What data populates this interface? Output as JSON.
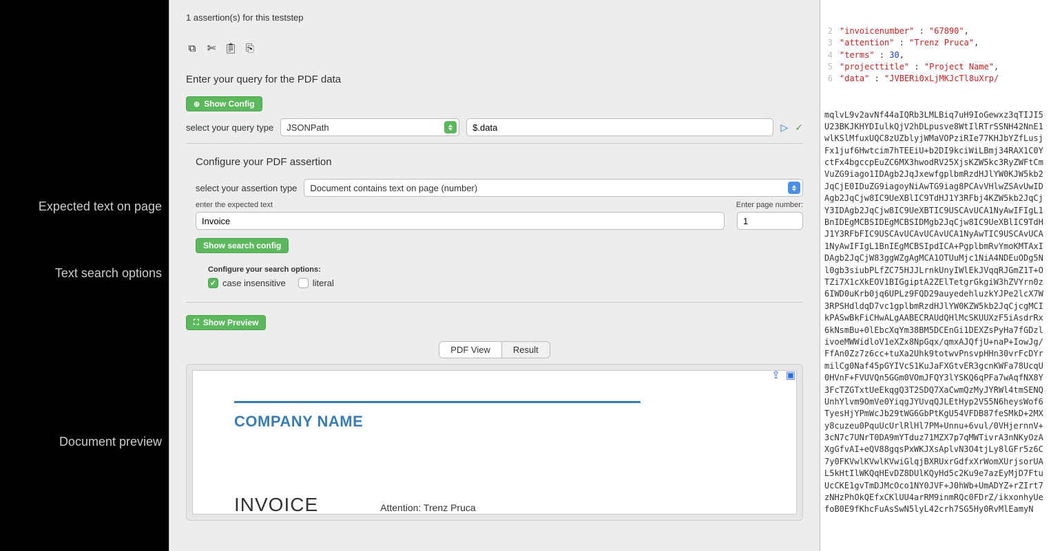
{
  "left_labels": {
    "l1": "Expected text on page",
    "l2": "Text search options",
    "l3": "Document preview"
  },
  "assertion_header": "1 assertion(s) for this teststep",
  "query_section": {
    "title": "Enter your query for the PDF data",
    "show_config_btn": "Show Config",
    "query_type_label": "select your query type",
    "query_type_value": "JSONPath",
    "query_input_value": "$.data"
  },
  "assertion_section": {
    "title": "Configure your PDF assertion",
    "type_label": "select your assertion type",
    "type_value": "Document contains text on page (number)",
    "expected_label": "enter the expected text",
    "page_label": "Enter page number:",
    "expected_value": "Invoice",
    "page_value": "1",
    "show_search_btn": "Show search config",
    "search_opts_title": "Configure your search options:",
    "case_insensitive_label": "case insensitive",
    "literal_label": "literal",
    "case_insensitive_checked": true,
    "literal_checked": false
  },
  "preview_section": {
    "show_preview_btn": "Show Preview",
    "tab_pdf": "PDF View",
    "tab_result": "Result"
  },
  "pdf": {
    "company": "COMPANY NAME",
    "invoice_word": "INVOICE",
    "attention": "Attention: Trenz Pruca"
  },
  "json_lines": [
    {
      "n": "2",
      "key": "invoicenumber",
      "val_str": "67890",
      "trail": ","
    },
    {
      "n": "3",
      "key": "attention",
      "val_str": "Trenz Pruca",
      "trail": ","
    },
    {
      "n": "4",
      "key": "terms",
      "val_num": "30",
      "trail": ","
    },
    {
      "n": "5",
      "key": "projecttitle",
      "val_str": "Project Name",
      "trail": ","
    },
    {
      "n": "6",
      "key": "data",
      "val_str_prefix": "JVBERi0xLjMKJcTl8uXrp/"
    }
  ],
  "base64_blob": "mqlvL9v2avNf44aIQRb3LMLBiq7uH9IoGewxz3qTIJI5U23BKJKHYDIulkQjV2hDLpusve8WtIlRTrSSNH42NnE1wlKSlMfuxUQC8zUZblyjWMaVOPziRIe77KHJbYZfLusjFx1juf6Hwtcim7hTEEiU+b2DI9kciWiLBmj34RAX1C0YctFx4bgccpEuZC6MX3hwodRV25XjsKZW5kc3RyZWFtCmVuZG9iago1IDAgb2JqJxewfgplbmRzdHJlYW0KJW5kb2JqCjE0IDuZG9iagoyNiAwTG9iag8PCAvVHlwZSAvUwIDAgb2JqCjw8IC9UeXBlIC9TdHJ1Y3RFbj4KZW5kb2JqCjY3IDAgb2JqCjw8IC9UeXBTIC9USCAvUCA1NyAwIFIgL1BnIDEgMCBSIDEgMCBSIDMgb2JqCjw8IC9UeXBlIC9TdHJ1Y3RFbFIC9USCAvUCAvUCAvUCA1NyAwTIC9USCAvUCA1NyAwIFIgL1BnIEgMCBSIpdICA+PgplbmRvYmoKMTAxIDAgb2JqCjW83ggWZgAgMCA1OTUuMjc1NiA4NDEuODg5Nl0gb3siubPLfZC75HJJLrnkUnyIWlEkJVqqRJGmZ1T+OTZi7X1cXkEOV1BIGgiptA2ZElTetgrGkgiW3hZVYrn0z6IWD0uKrb0jq6UPLz9FQD29auyedehluzkYJPe2lcX7W3RPSHdldqD7vc1gplbmRzdHJlYW0KZW5kb2JqCjcgMCIkPASwBkFiCHwALgAABECRAUdQHlMcSKUUXzF5iAsdrRx6kNsmBu+0lEbcXqYm38BM5DCEnGi1DEXZsPyHa7fGDzlivoeMWWidloV1eXZx8NpGqx/qmxAJQfjU+naP+IowJg/FfAn0Zz7z6cc+tuXa2Uhk9totwvPnsvpHHn30vrFcDYrmilCg0Naf45pGYIVcS1KuJaFXGtvER3gcnKWFa78UcqU0HVnF+FVUVQn5GGm0VOmJFQY3lYSKQ6qPFa7wAqfNX8Y3FcTZGTxtUeEkqgQ3T2SDQ7XaCwmQzMyJYRWl4tmSENQUnhYlvm9OmVe0YiqgJYUvqQJLEtHyp2V55N6heysWof6TyesHjYPmWcJb29tWG6GbPtKgU54VFDB87feSMkD+2MXy8cuzeu0PquUcUrlRlHl7PM+Unnu+6vul/0VHjernnV+3cN7c7UNrT0DA9mYTduz71MZX7p7qMWTivrA3nNKyOzAXgGfvAI+eQV88gqsPxWKJXsAplvN3O4tjLy8lGFr5z6C7y0FKVwlKVwlKVwiGlqjBXRUxrGdfxXrWomXUrjsorUAL5kHtIlWKQqHEvDZ8DUlKQyHd5c2Ku9e7azEyMjD7FtuUcCKE1gvTmDJMcOco1NY0JVF+J0hWb+UmADYZ+rZIrt7zNHzPhOkQEfxCKlUU4arRM9inmRQc0FDrZ/ikxonhyUefoB0E9fKhcFuAsSwN5lyL42crh7SG5Hy0RvMlEamyN"
}
